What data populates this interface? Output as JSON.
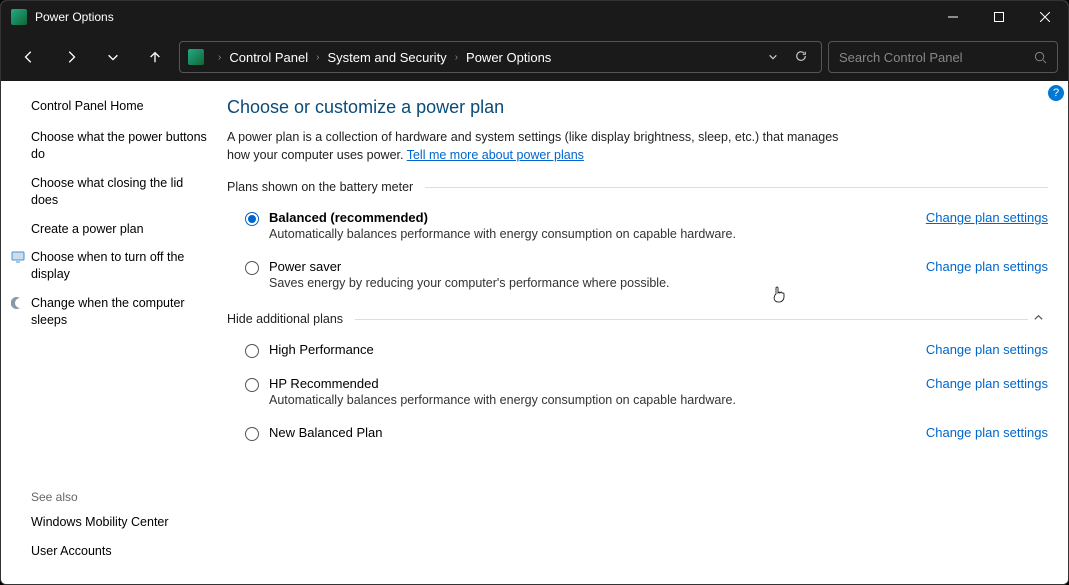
{
  "title": "Power Options",
  "breadcrumbs": [
    "Control Panel",
    "System and Security",
    "Power Options"
  ],
  "search_placeholder": "Search Control Panel",
  "sidebar": {
    "home": "Control Panel Home",
    "links": [
      "Choose what the power buttons do",
      "Choose what closing the lid does",
      "Create a power plan",
      "Choose when to turn off the display",
      "Change when the computer sleeps"
    ],
    "see_also_label": "See also",
    "see_also": [
      "Windows Mobility Center",
      "User Accounts"
    ]
  },
  "main": {
    "heading": "Choose or customize a power plan",
    "intro": "A power plan is a collection of hardware and system settings (like display brightness, sleep, etc.) that manages how your computer uses power. ",
    "intro_link": "Tell me more about power plans",
    "section1": "Plans shown on the battery meter",
    "section2": "Hide additional plans",
    "change_link": "Change plan settings",
    "plans_visible": [
      {
        "name": "Balanced (recommended)",
        "desc": "Automatically balances performance with energy consumption on capable hardware.",
        "selected": true
      },
      {
        "name": "Power saver",
        "desc": "Saves energy by reducing your computer's performance where possible.",
        "selected": false
      }
    ],
    "plans_additional": [
      {
        "name": "High Performance",
        "desc": "",
        "selected": false
      },
      {
        "name": "HP Recommended",
        "desc": "Automatically balances performance with energy consumption on capable hardware.",
        "selected": false
      },
      {
        "name": "New Balanced Plan",
        "desc": "",
        "selected": false
      }
    ]
  }
}
